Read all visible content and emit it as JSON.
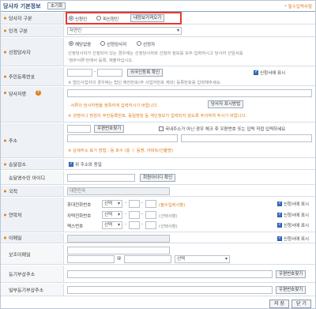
{
  "header": {
    "title": "당사자 기본정보",
    "toggle_label": "초기화",
    "required_note": "* 필수입력사항"
  },
  "party_type": {
    "label": "당사자 구분",
    "opt1": "신청인",
    "opt2": "피신청인",
    "load_btn": "내정보가져오기"
  },
  "person_type": {
    "label": "인격 구분",
    "value": "자연인"
  },
  "designated": {
    "label": "선정당사자",
    "opt1": "해당없음",
    "opt2": "선정당사자",
    "opt3": "선정자",
    "desc1": "선정당사자가 선정되어 있는 경우에는 선정당사자와 선정자 정보를 모두 입력하시고 당사자 선임서를",
    "desc2": "'첨부서류'란에서 등록, 제출하십시오."
  },
  "rrn": {
    "label": "주민등록번호",
    "verify_btn": "외국인등록 확인",
    "show_label": "신청서에 표시",
    "note": "※ 법인사업자의 경우에는 법인 제한번호(주 사업자번호 제외) 등록번호를 입력해주세요."
  },
  "name": {
    "label": "당사자명",
    "help": "?",
    "note1": "· 서류의 당사자명을 정확하게 입력하시기 바랍니다.",
    "display_btn": "당사자 표시방법",
    "note2": "※ 성명이나 명칭의 주민등록번호, 동일명칭 등 개인정보가 입력되지 않도록 주의하여 주시기 바랍니다."
  },
  "address": {
    "label": "주소",
    "zip_btn": "우편번호찾기",
    "foreign_label": "국내주소가 아닌 경우 체크 후 우편번호 또는 입력 직접 입력하세요",
    "note": "※ 상세주소 표기 방법 : 동 호수 (층 ㅣ 동명, 아파트/건물명)"
  },
  "delivery": {
    "label": "송달장소",
    "same_label": "위 주소와 동일"
  },
  "recipient": {
    "label": "송달영수인 아이디",
    "confirm_btn": "회원아이디 확인"
  },
  "nationality": {
    "label": "국적",
    "value": "대한민국"
  },
  "contact": {
    "label": "연락처",
    "mobile": {
      "label": "휴대전화번호",
      "sel": "선택",
      "req": "(필수입력사항)",
      "show": "신청서에 표시"
    },
    "home": {
      "label": "자택전화번호",
      "sel": "선택",
      "opt": "(선택사항)",
      "show": "신청서에 표시"
    },
    "fax": {
      "label": "팩스번호",
      "sel": "선택",
      "opt": "(선택사항)",
      "show": "신청서에 표시"
    }
  },
  "email": {
    "label": "이메일",
    "show": "신청서에 표시"
  },
  "post_email": {
    "label": "보조이메일",
    "sel": "선택"
  },
  "reg_addr": {
    "label": "등기부상주소",
    "zip_btn": "우편번호찾기"
  },
  "reg_addr2": {
    "label": "일부등기부상주소",
    "zip_btn": "우편번호찾기"
  },
  "footer": {
    "save": "저 장",
    "close": "닫 기"
  },
  "colors": {
    "accent": "#e07d18",
    "highlight": "#e53935"
  }
}
